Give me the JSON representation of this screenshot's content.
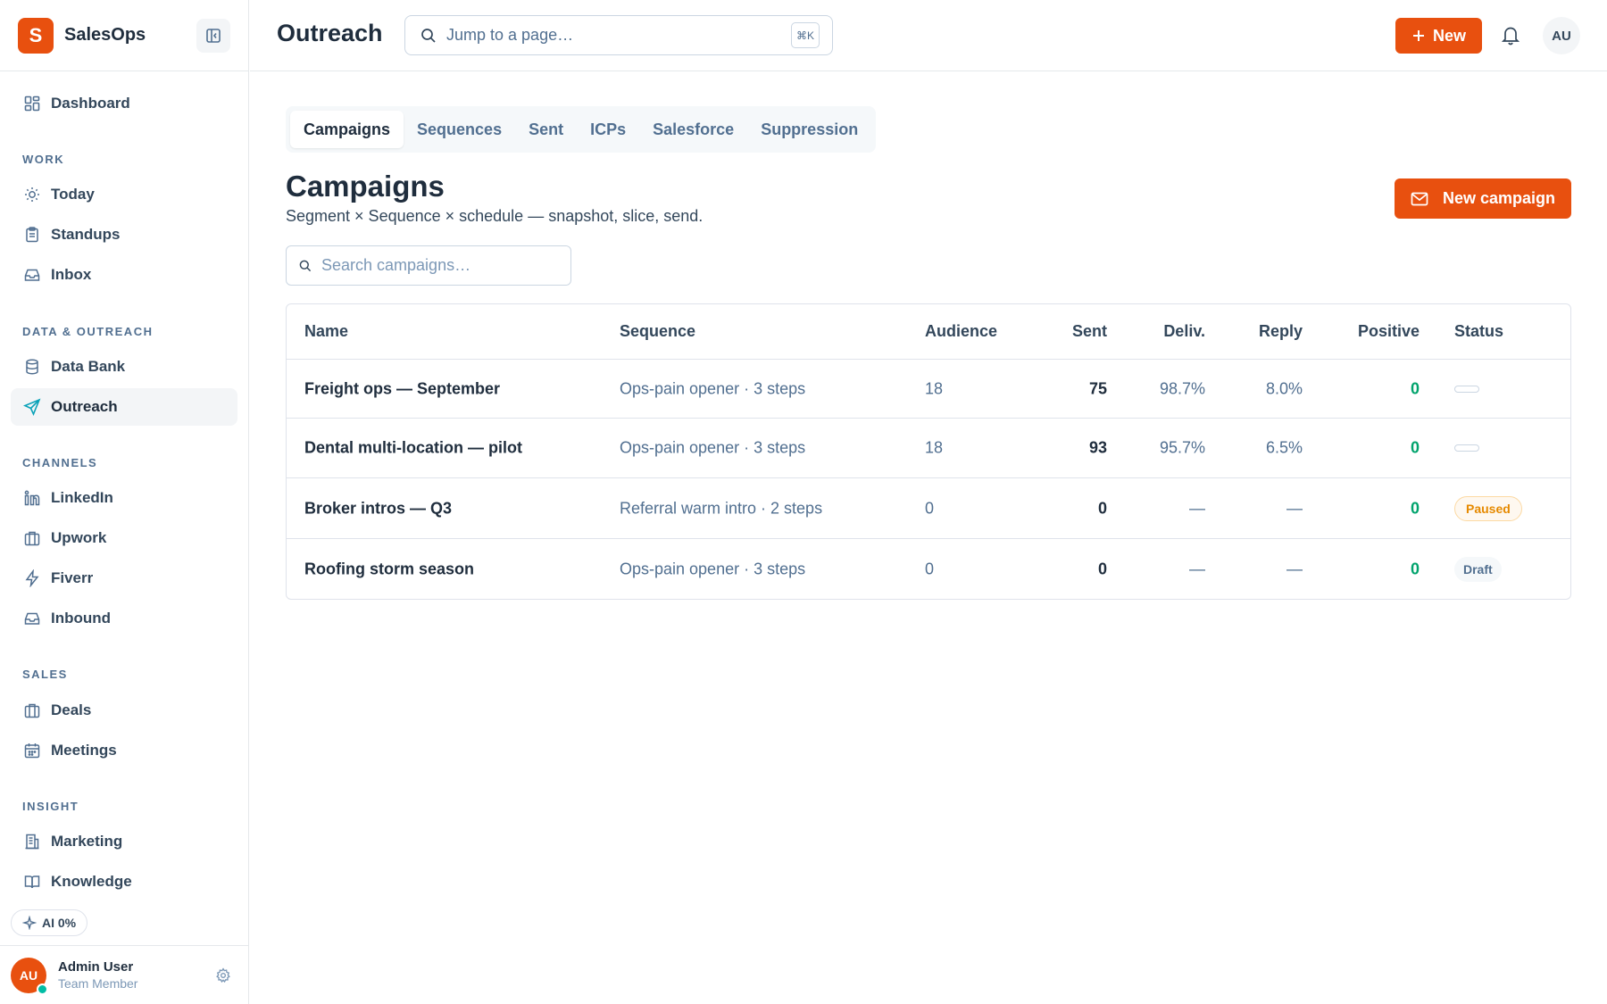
{
  "brand": {
    "logo_letter": "S",
    "name": "SalesOps"
  },
  "sidebar": {
    "nav_top": {
      "label": "Dashboard",
      "icon": "dashboard-icon"
    },
    "sections": [
      {
        "label": "WORK",
        "items": [
          {
            "label": "Today",
            "icon": "sun-icon"
          },
          {
            "label": "Standups",
            "icon": "clipboard-icon"
          },
          {
            "label": "Inbox",
            "icon": "inbox-icon"
          }
        ]
      },
      {
        "label": "DATA & OUTREACH",
        "items": [
          {
            "label": "Data Bank",
            "icon": "database-icon"
          },
          {
            "label": "Outreach",
            "icon": "send-icon",
            "active": true
          }
        ]
      },
      {
        "label": "CHANNELS",
        "items": [
          {
            "label": "LinkedIn",
            "icon": "linkedin-icon"
          },
          {
            "label": "Upwork",
            "icon": "briefcase-icon"
          },
          {
            "label": "Fiverr",
            "icon": "lightning-icon"
          },
          {
            "label": "Inbound",
            "icon": "inbox-icon"
          }
        ]
      },
      {
        "label": "SALES",
        "items": [
          {
            "label": "Deals",
            "icon": "briefcase-icon"
          },
          {
            "label": "Meetings",
            "icon": "calendar-icon"
          }
        ]
      },
      {
        "label": "INSIGHT",
        "items": [
          {
            "label": "Marketing",
            "icon": "building-icon"
          },
          {
            "label": "Knowledge",
            "icon": "book-icon"
          }
        ]
      }
    ],
    "ai_pill": "AI 0%",
    "user": {
      "initials": "AU",
      "name": "Admin User",
      "role": "Team Member"
    }
  },
  "topbar": {
    "title": "Outreach",
    "search_placeholder": "Jump to a page…",
    "shortcut": "⌘K",
    "new_label": "New",
    "avatar_initials": "AU"
  },
  "main": {
    "tabs": [
      "Campaigns",
      "Sequences",
      "Sent",
      "ICPs",
      "Salesforce",
      "Suppression"
    ],
    "active_tab": "Campaigns",
    "title": "Campaigns",
    "subtitle": "Segment × Sequence × schedule — snapshot, slice, send.",
    "new_campaign_label": "New campaign",
    "search_placeholder": "Search campaigns…",
    "table": {
      "columns": [
        "Name",
        "Sequence",
        "Audience",
        "Sent",
        "Deliv.",
        "Reply",
        "Positive",
        "Status"
      ],
      "rows": [
        {
          "name": "Freight ops — September",
          "sequence": "Ops-pain opener · 3 steps",
          "audience": "18",
          "sent": "75",
          "deliv": "98.7%",
          "reply": "8.0%",
          "positive": "0",
          "status": ""
        },
        {
          "name": "Dental multi-location — pilot",
          "sequence": "Ops-pain opener · 3 steps",
          "audience": "18",
          "sent": "93",
          "deliv": "95.7%",
          "reply": "6.5%",
          "positive": "0",
          "status": ""
        },
        {
          "name": "Broker intros — Q3",
          "sequence": "Referral warm intro · 2 steps",
          "audience": "0",
          "sent": "0",
          "deliv": "—",
          "reply": "—",
          "positive": "0",
          "status": "Paused"
        },
        {
          "name": "Roofing storm season",
          "sequence": "Ops-pain opener · 3 steps",
          "audience": "0",
          "sent": "0",
          "deliv": "—",
          "reply": "—",
          "positive": "0",
          "status": "Draft"
        }
      ]
    }
  },
  "colors": {
    "accent": "#e8500f",
    "positive": "#00a36c",
    "paused": "#e68a00",
    "active_icon": "#0aa2b8"
  }
}
